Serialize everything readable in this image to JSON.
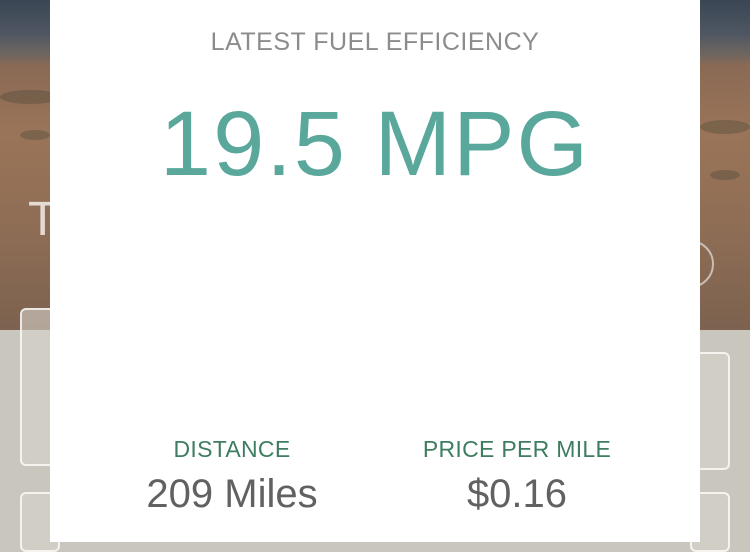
{
  "background": {
    "title_fragment": "T",
    "camera_icon": "camera-icon"
  },
  "modal": {
    "heading": "LATEST FUEL EFFICIENCY",
    "efficiency": "19.5 MPG",
    "stats": [
      {
        "label": "DISTANCE",
        "value": "209 Miles"
      },
      {
        "label": "PRICE PER MILE",
        "value": "$0.16"
      }
    ]
  },
  "colors": {
    "accent": "#5aa79c",
    "label": "#3e7d5f",
    "value": "#616161",
    "heading": "#8c8c8c"
  }
}
